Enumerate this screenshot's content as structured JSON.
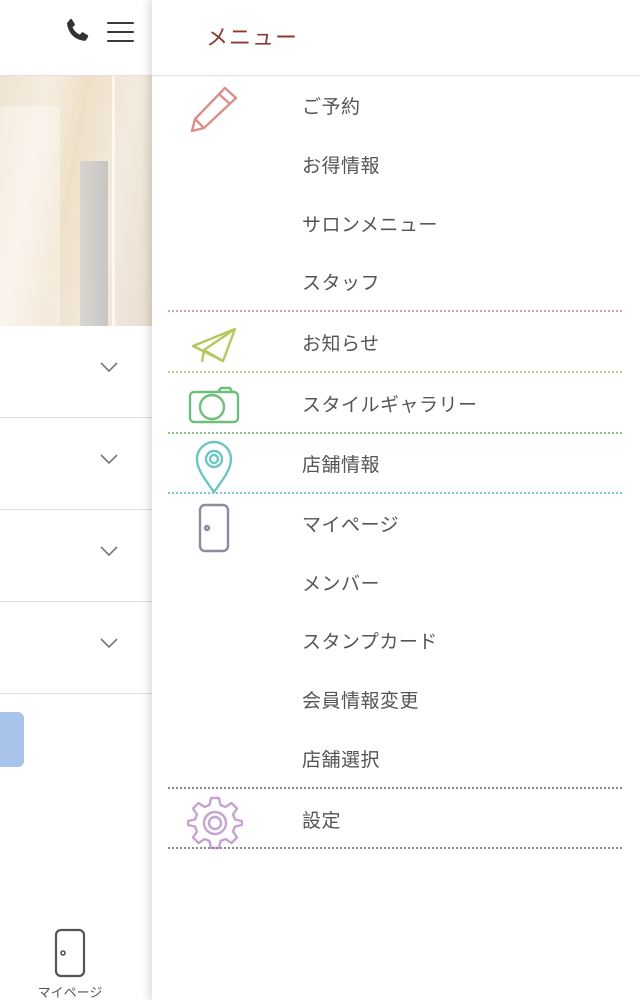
{
  "drawer": {
    "title": "メニュー",
    "groups": [
      {
        "icon": "pencil-icon",
        "color": "#d9908a",
        "items": [
          "ご予約",
          "お得情報",
          "サロンメニュー",
          "スタッフ"
        ]
      },
      {
        "icon": "paper-plane-icon",
        "color": "#b3c85f",
        "items": [
          "お知らせ"
        ]
      },
      {
        "icon": "camera-icon",
        "color": "#6cbf7a",
        "items": [
          "スタイルギャラリー"
        ]
      },
      {
        "icon": "map-pin-icon",
        "color": "#6ec5c8",
        "items": [
          "店舗情報"
        ]
      },
      {
        "icon": "door-icon",
        "color": "#8e8aa0",
        "items": [
          "マイページ",
          "メンバー",
          "スタンプカード",
          "会員情報変更",
          "店舗選択"
        ]
      },
      {
        "icon": "gear-icon",
        "color": "#c7a3d3",
        "items": [
          "設定"
        ]
      }
    ],
    "divider_colors": [
      "#d9a3a3",
      "#c9c97a",
      "#8abf8a",
      "#7ec8cc",
      "#8a8a8a",
      "#8a8a8a"
    ]
  },
  "background": {
    "bottom_nav": {
      "mypage_label": "マイページ"
    }
  }
}
